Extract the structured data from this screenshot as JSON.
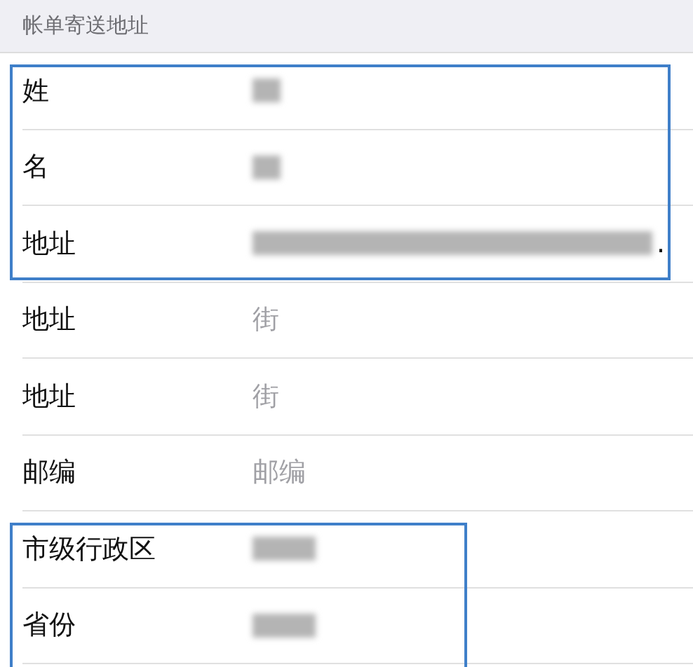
{
  "section_header": "帐单寄送地址",
  "groups": [
    {
      "highlighted": true,
      "rows": [
        {
          "label": "姓",
          "value": {
            "kind": "redacted"
          }
        },
        {
          "label": "名",
          "value": {
            "kind": "redacted"
          }
        },
        {
          "label": "地址",
          "value": {
            "kind": "redacted",
            "trailing": "."
          }
        }
      ]
    },
    {
      "highlighted": false,
      "rows": [
        {
          "label": "地址",
          "value": {
            "kind": "empty",
            "placeholder": "街"
          }
        },
        {
          "label": "地址",
          "value": {
            "kind": "empty",
            "placeholder": "街"
          }
        },
        {
          "label": "邮编",
          "value": {
            "kind": "empty",
            "placeholder": "邮编"
          }
        }
      ]
    },
    {
      "highlighted": true,
      "rows": [
        {
          "label": "市级行政区",
          "value": {
            "kind": "redacted"
          }
        },
        {
          "label": "省份",
          "value": {
            "kind": "redacted"
          }
        }
      ]
    }
  ]
}
